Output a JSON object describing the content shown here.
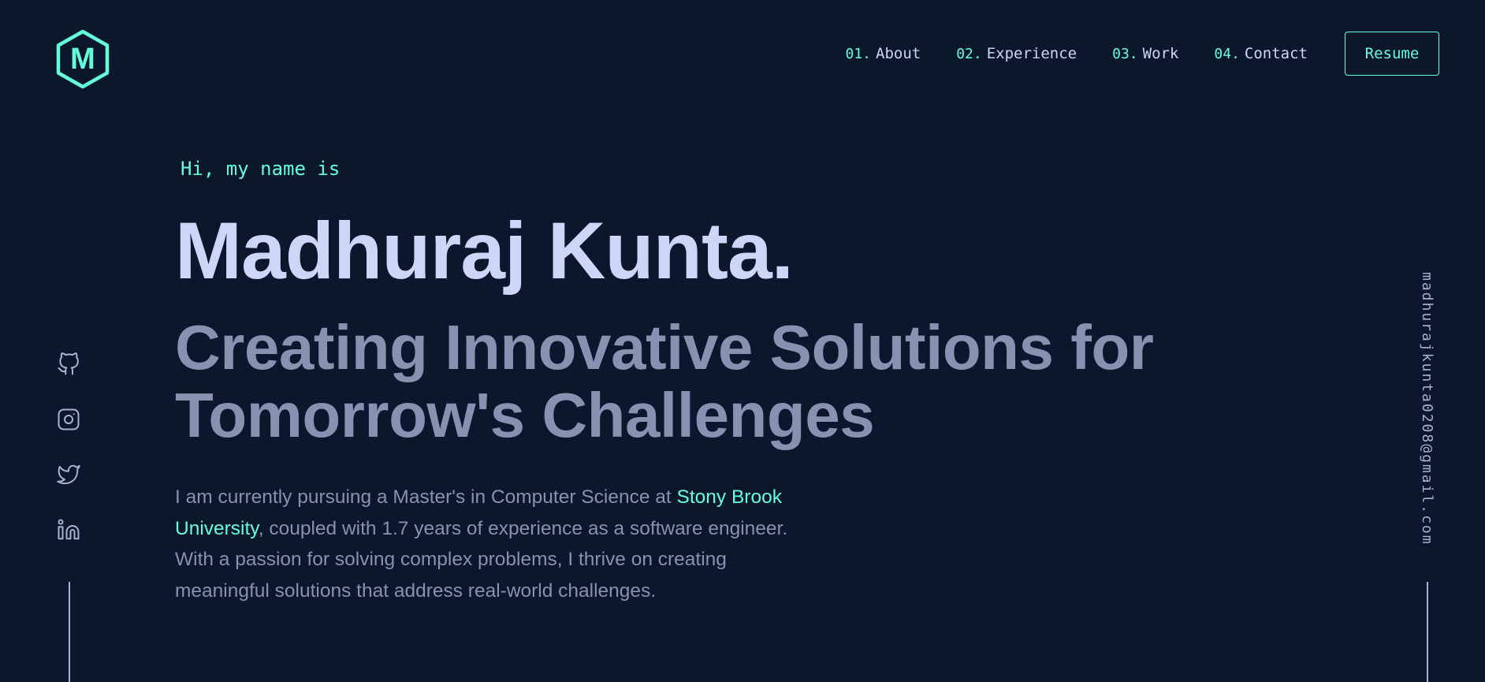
{
  "header": {
    "logo_letter": "M",
    "logo_icon": "hexagon-logo-icon",
    "nav": [
      {
        "num": "01.",
        "label": "About"
      },
      {
        "num": "02.",
        "label": "Experience"
      },
      {
        "num": "03.",
        "label": "Work"
      },
      {
        "num": "04.",
        "label": "Contact"
      }
    ],
    "resume_label": "Resume"
  },
  "hero": {
    "greeting": "Hi, my name is",
    "name": "Madhuraj Kunta.",
    "tagline": "Creating Innovative Solutions for Tomorrow's Challenges",
    "bio_before": "I am currently pursuing a Master's in Computer Science at ",
    "bio_highlight": "Stony Brook University",
    "bio_after": ", coupled with 1.7 years of experience as a software engineer. With a passion for solving complex problems, I thrive on creating meaningful solutions that address real-world challenges."
  },
  "socials": [
    {
      "icon": "github-icon"
    },
    {
      "icon": "instagram-icon"
    },
    {
      "icon": "twitter-icon"
    },
    {
      "icon": "linkedin-icon"
    }
  ],
  "email": "madhurajkunta0208@gmail.com",
  "colors": {
    "background": "#0b172d",
    "accent": "#64ffda",
    "heading": "#ccd6f6",
    "text": "#8892b0"
  }
}
